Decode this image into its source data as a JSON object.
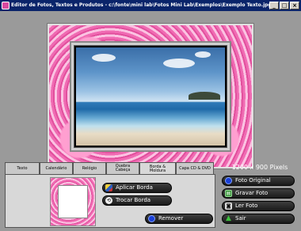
{
  "window": {
    "title": "Editor de Fotos, Textos e Produtos - c:\\fonte\\mini lab\\Fotos Mini Lab\\Exemplos\\Exemplo Texto.jpg",
    "min_label": "_",
    "max_label": "□",
    "close_label": "×"
  },
  "tabs": [
    {
      "label": "Texto"
    },
    {
      "label": "Calendário"
    },
    {
      "label": "Relógio"
    },
    {
      "label": "Quebra Cabeça"
    },
    {
      "label": "Borda & Moldura"
    },
    {
      "label": "Capa CD & DVD"
    }
  ],
  "pixel_info": "1200 x 900 Pixels",
  "buttons": {
    "aplicar_borda": "Aplicar Borda",
    "trocar_borda": "Trocar Borda",
    "remover": "Remover",
    "foto_original": "Foto Original",
    "gravar_foto": "Gravar Foto",
    "ler_foto": "Ler Foto",
    "sair": "Sair"
  },
  "icons": {
    "aplicar_borda": "brush-icon",
    "trocar_borda": "swap-icon",
    "remover": "no-icon",
    "foto_original": "no-icon",
    "gravar_foto": "save-icon",
    "ler_foto": "camera-icon",
    "sair": "up-arrow-icon"
  },
  "colors": {
    "titlebar": "#0a246a",
    "frame_pink": "#f06bb3",
    "button_bg": "#2a2a2a"
  }
}
